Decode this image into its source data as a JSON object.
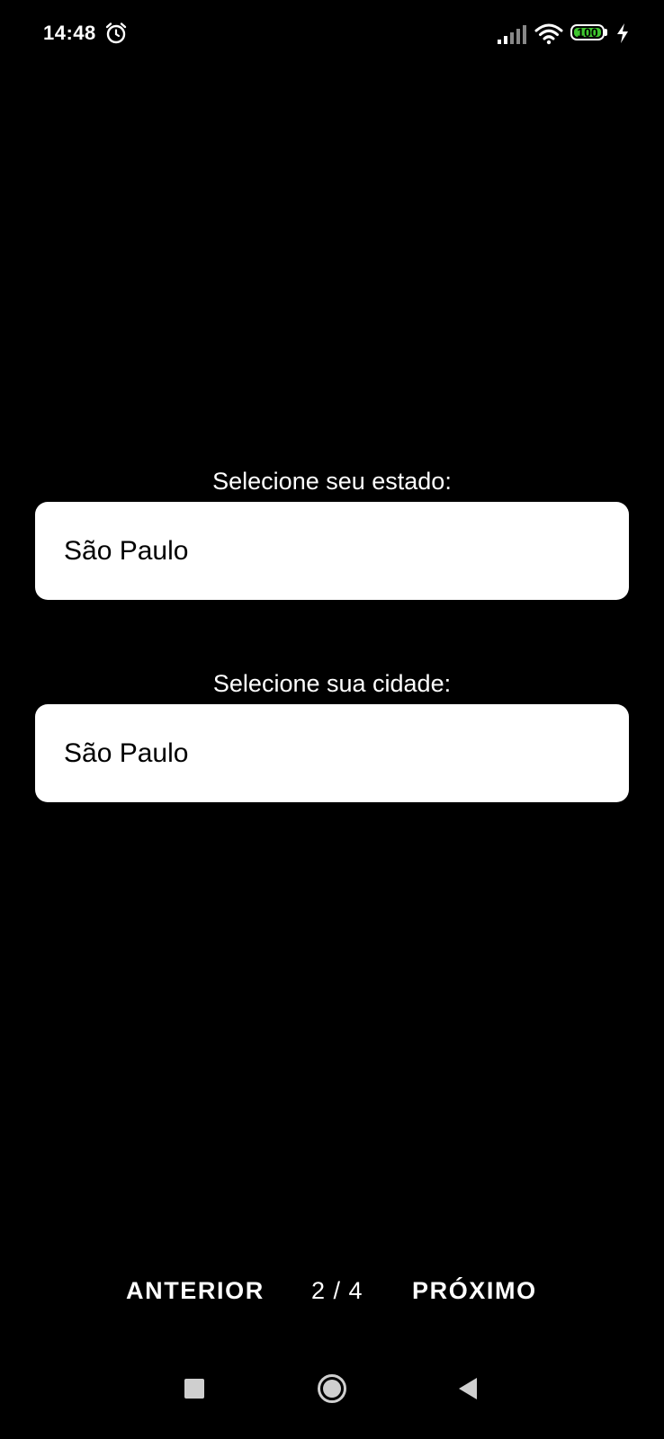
{
  "status_bar": {
    "time": "14:48",
    "battery": "100",
    "battery_level": 1.0,
    "icons": [
      "alarm-icon",
      "signal-icon",
      "wifi-icon",
      "battery-icon",
      "charging-icon"
    ]
  },
  "form": {
    "state_label": "Selecione seu estado:",
    "state_value": "São Paulo",
    "city_label": "Selecione sua cidade:",
    "city_value": "São Paulo"
  },
  "footer": {
    "prev_label": "ANTERIOR",
    "page_indicator": "2 / 4",
    "next_label": "PRÓXIMO"
  },
  "navigation": {
    "icons": [
      "recent-apps-icon",
      "home-icon",
      "back-icon"
    ]
  },
  "colors": {
    "background": "#000000",
    "field_background": "#ffffff",
    "battery_fill": "#3fc72f"
  }
}
